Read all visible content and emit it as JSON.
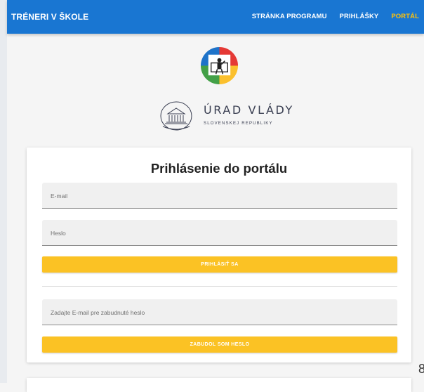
{
  "header": {
    "title": "TRÉNERI V ŠKOLE",
    "nav": [
      {
        "label": "STRÁNKA PROGRAMU",
        "active": false
      },
      {
        "label": "PRIHLÁŠKY",
        "active": false
      },
      {
        "label": "PORTÁL",
        "active": true
      }
    ]
  },
  "branding": {
    "program_logo": "program-logo-icon",
    "gov_name": "ÚRAD VLÁDY",
    "gov_subtitle": "SLOVENSKEJ REPUBLIKY",
    "gov_logo": "government-building-icon"
  },
  "login": {
    "title": "Prihlásenie do portálu",
    "email_label": "E-mail",
    "password_label": "Heslo",
    "login_button": "PRIHLÁSIŤ SA",
    "reset_label": "Zadajte E-mail pre zabudnuté heslo",
    "reset_button": "ZABUDOL SOM HESLO"
  },
  "colors": {
    "app_bar": "#1976d2",
    "accent": "#ffc107",
    "button": "#fbc224"
  },
  "footer_fragment": "8"
}
